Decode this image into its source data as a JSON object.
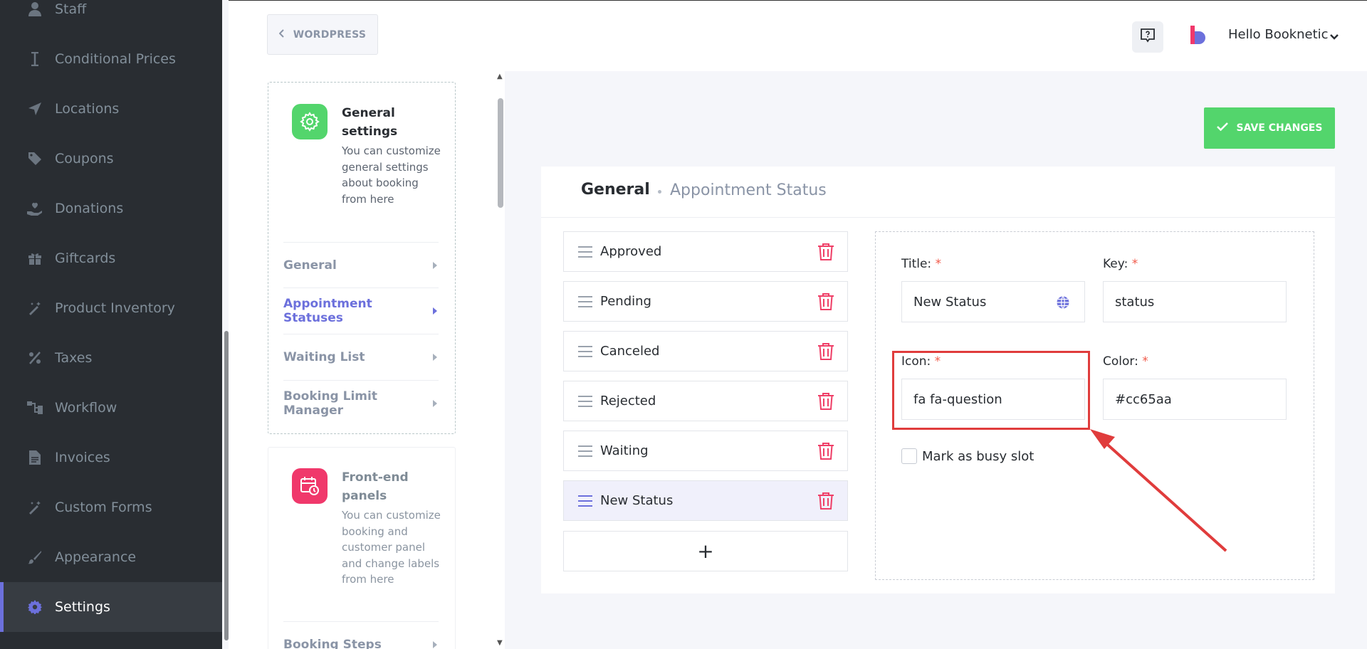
{
  "sidebar": {
    "items": [
      {
        "label": "Staff",
        "icon": "user-icon"
      },
      {
        "label": "Conditional Prices",
        "icon": "i-beam-icon"
      },
      {
        "label": "Locations",
        "icon": "location-arrow-icon"
      },
      {
        "label": "Coupons",
        "icon": "tag-icon"
      },
      {
        "label": "Donations",
        "icon": "hand-holding-heart-icon"
      },
      {
        "label": "Giftcards",
        "icon": "gift-icon"
      },
      {
        "label": "Product Inventory",
        "icon": "magic-wand-icon"
      },
      {
        "label": "Taxes",
        "icon": "percent-icon"
      },
      {
        "label": "Workflow",
        "icon": "sitemap-icon"
      },
      {
        "label": "Invoices",
        "icon": "file-icon"
      },
      {
        "label": "Custom Forms",
        "icon": "magic-wand-icon"
      },
      {
        "label": "Appearance",
        "icon": "brush-icon"
      },
      {
        "label": "Settings",
        "icon": "gear-icon"
      }
    ],
    "active": "Settings"
  },
  "header": {
    "wordpress_label": "WORDPRESS",
    "greeting": "Hello Booknetic"
  },
  "settings_menu": {
    "general_card": {
      "title": "General settings",
      "description": "You can customize general settings about booking from here",
      "items": [
        "General",
        "Appointment Statuses",
        "Waiting List",
        "Booking Limit Manager"
      ],
      "active_item": "Appointment Statuses"
    },
    "frontend_card": {
      "title": "Front-end panels",
      "description": "You can customize booking and customer panel and change labels from here",
      "items": [
        "Booking Steps"
      ]
    }
  },
  "toolbar": {
    "save_label": "SAVE CHANGES"
  },
  "breadcrumb": {
    "main": "General",
    "sub": "Appointment Status"
  },
  "statuses": [
    {
      "name": "Approved"
    },
    {
      "name": "Pending"
    },
    {
      "name": "Canceled"
    },
    {
      "name": "Rejected"
    },
    {
      "name": "Waiting"
    },
    {
      "name": "New Status",
      "selected": true
    }
  ],
  "add_label": "+",
  "form": {
    "title_label": "Title:",
    "title_value": "New Status",
    "key_label": "Key:",
    "key_value": "status",
    "icon_label": "Icon:",
    "icon_value": "fa fa-question",
    "color_label": "Color:",
    "color_value": "#cc65aa",
    "required_mark": "*",
    "busy_label": "Mark as busy slot",
    "busy_checked": false
  },
  "colors": {
    "accent": "#6c70dc",
    "save_green": "#53d56c",
    "danger": "#ef3f67",
    "annotation_red": "#e03c3c"
  }
}
